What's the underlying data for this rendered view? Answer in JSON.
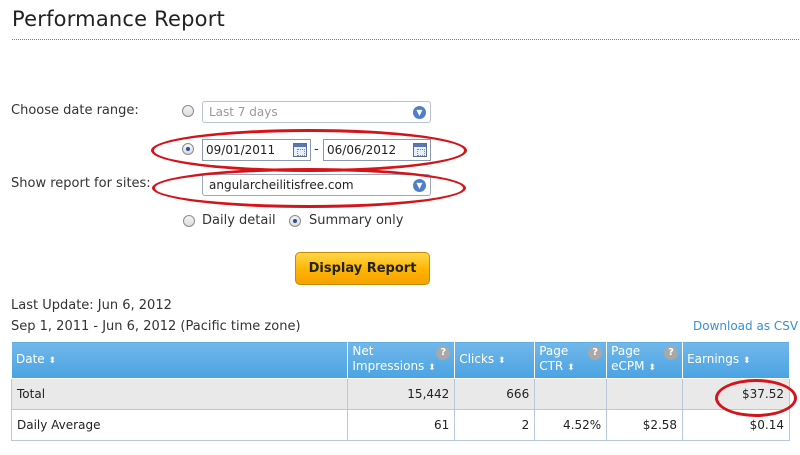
{
  "page": {
    "title": "Performance Report"
  },
  "form": {
    "date_range_label": "Choose date range:",
    "preset_range": "Last 7 days",
    "start_date": "09/01/2011",
    "date_separator": "-",
    "end_date": "06/06/2012",
    "sites_label": "Show report for sites:",
    "site": "angularcheilitisfree.com",
    "daily_detail_label": "Daily detail",
    "summary_only_label": "Summary only",
    "display_button": "Display Report"
  },
  "report": {
    "last_update": "Last Update: Jun 6, 2012",
    "range_text": "Sep 1, 2011 - Jun 6, 2012 (Pacific time zone)",
    "download_link": "Download as CSV",
    "sort_glyph": "⬍",
    "help_glyph": "?",
    "columns": {
      "date": "Date",
      "net_impressions_1": "Net",
      "net_impressions_2": "Impressions",
      "clicks": "Clicks",
      "page_ctr_1": "Page",
      "page_ctr_2": "CTR",
      "page_ecpm_1": "Page",
      "page_ecpm_2": "eCPM",
      "earnings": "Earnings"
    },
    "rows": [
      {
        "label": "Total",
        "impressions": "15,442",
        "clicks": "666",
        "ctr": "",
        "ecpm": "",
        "earnings": "$37.52"
      },
      {
        "label": "Daily Average",
        "impressions": "61",
        "clicks": "2",
        "ctr": "4.52%",
        "ecpm": "$2.58",
        "earnings": "$0.14"
      }
    ]
  },
  "colors": {
    "accent_header": "#4aa3e2",
    "annotation_oval": "#d4131a",
    "button": "#ffb400",
    "link": "#3b8fd1"
  }
}
